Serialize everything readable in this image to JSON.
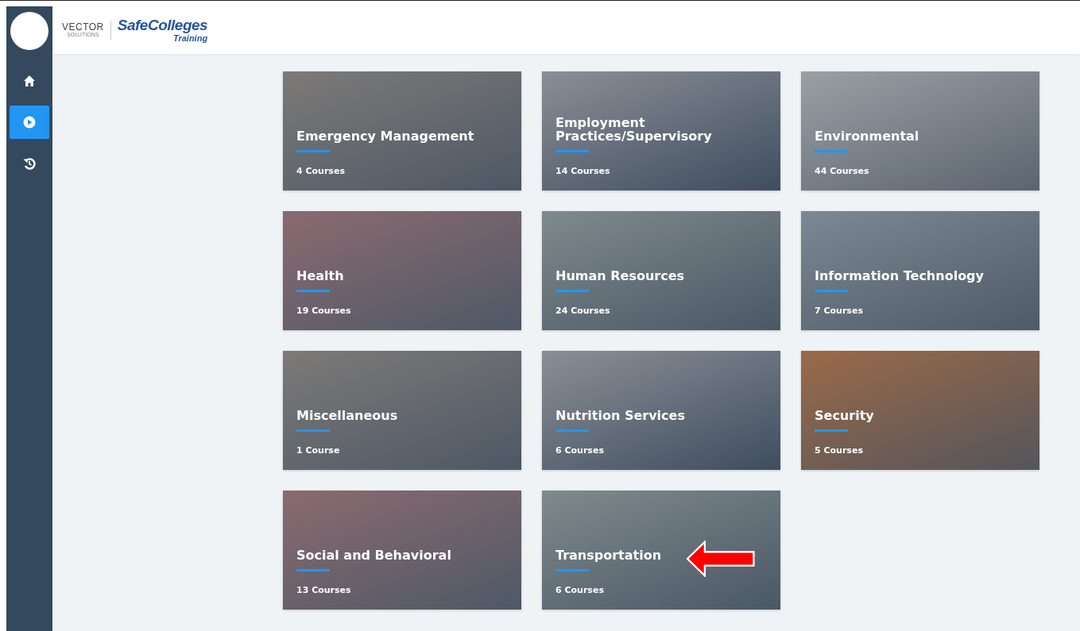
{
  "sidebar": {
    "items": [
      {
        "kind": "home",
        "selected": false
      },
      {
        "kind": "play",
        "selected": true
      },
      {
        "kind": "history",
        "selected": false
      }
    ]
  },
  "header": {
    "logo_primary": "VECTOR",
    "logo_primary_sub": "SOLUTIONS",
    "logo_secondary": "SafeColleges",
    "logo_secondary_sub": "Training"
  },
  "category_rows": [
    {
      "categories": [
        {
          "title": "Emergency Management",
          "count": "4 Courses"
        },
        {
          "title": "Employment Practices/Supervisory",
          "count": "14 Courses"
        },
        {
          "title": "Environmental",
          "count": "44 Courses"
        }
      ]
    },
    {
      "categories": [
        {
          "title": "Health",
          "count": "19 Courses"
        },
        {
          "title": "Human Resources",
          "count": "24 Courses"
        },
        {
          "title": "Information Technology",
          "count": "7 Courses"
        }
      ]
    },
    {
      "categories": [
        {
          "title": "Miscellaneous",
          "count": "1 Course"
        },
        {
          "title": "Nutrition Services",
          "count": "6 Courses"
        },
        {
          "title": "Security",
          "count": "5 Courses"
        }
      ]
    },
    {
      "categories": [
        {
          "title": "Social and Behavioral",
          "count": "13 Courses"
        },
        {
          "title": "Transportation",
          "count": "6 Courses",
          "annotated": true
        }
      ]
    }
  ]
}
